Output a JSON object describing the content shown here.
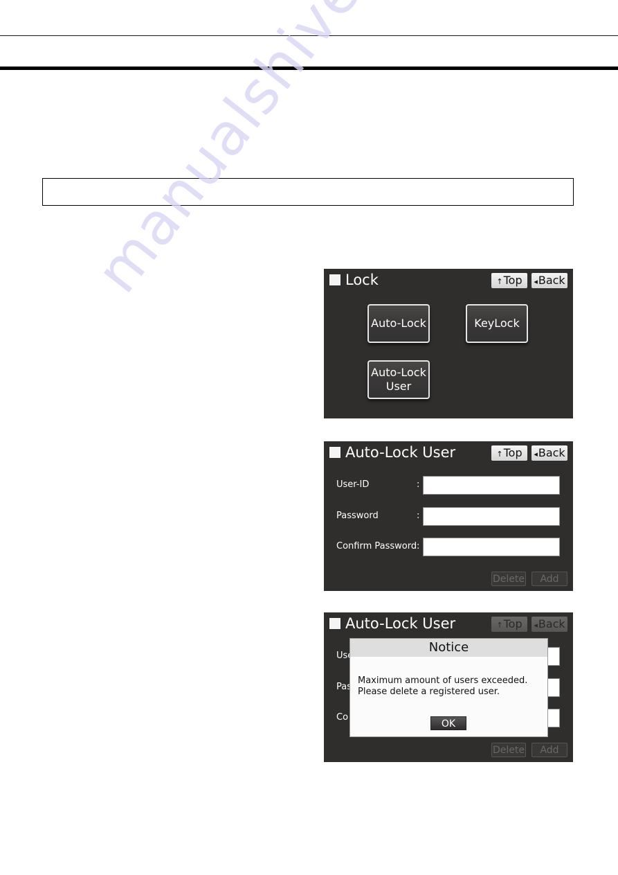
{
  "document": {
    "watermark": "manualshive.com"
  },
  "screens": [
    {
      "title": "Lock",
      "nav": {
        "top_label": "Top",
        "back_label": "Back",
        "top_icon": "up-arrow-icon",
        "back_icon": "left-triangle-icon"
      },
      "buttons": [
        {
          "label": "Auto-Lock"
        },
        {
          "label": "KeyLock"
        },
        {
          "label_line1": "Auto-Lock",
          "label_line2": "User"
        }
      ]
    },
    {
      "title": "Auto-Lock User",
      "nav": {
        "top_label": "Top",
        "back_label": "Back"
      },
      "fields": [
        {
          "label": "User-ID",
          "value": ""
        },
        {
          "label": "Password",
          "value": ""
        },
        {
          "label": "Confirm Password",
          "value": ""
        }
      ],
      "colon": ":",
      "footer": {
        "delete_label": "Delete",
        "add_label": "Add",
        "state": "disabled"
      }
    },
    {
      "title": "Auto-Lock User",
      "nav": {
        "top_label": "Top",
        "back_label": "Back",
        "state": "dimmed"
      },
      "fields_partial": [
        "Use",
        "Pas",
        "Co"
      ],
      "footer": {
        "delete_label": "Delete",
        "add_label": "Add",
        "state": "disabled"
      },
      "dialog": {
        "title": "Notice",
        "message_line1": "Maximum amount of users exceeded.",
        "message_line2": "Please delete a registered user.",
        "ok_label": "OK"
      }
    }
  ],
  "colors": {
    "panel_bg": "#302d2d",
    "watermark": "#d9d7f5"
  }
}
